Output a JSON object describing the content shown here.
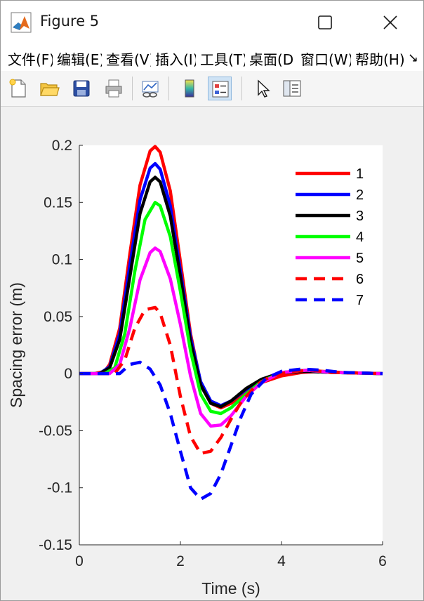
{
  "window": {
    "title": "Figure 5"
  },
  "menu": {
    "items": [
      "文件(F)",
      "编辑(E)",
      "查看(V)",
      "插入(I)",
      "工具(T)",
      "桌面(D)",
      "窗口(W)",
      "帮助(H)"
    ],
    "overflow_glyph": "↘"
  },
  "toolbar": {
    "buttons": [
      {
        "icon": "new-figure-icon"
      },
      {
        "icon": "open-file-icon"
      },
      {
        "icon": "save-icon"
      },
      {
        "icon": "print-icon"
      },
      {
        "icon": "link-plot-icon"
      },
      {
        "icon": "colorbar-icon"
      },
      {
        "icon": "legend-icon",
        "active": true
      },
      {
        "icon": "pointer-icon"
      },
      {
        "icon": "property-inspector-icon"
      }
    ]
  },
  "colors": {
    "accent_active": "#cfe3f5",
    "plot_background": "#ffffff",
    "figure_background": "#f0f0f0"
  },
  "chart_data": {
    "type": "line",
    "title": "",
    "xlabel": "Time (s)",
    "ylabel": "Spacing error (m)",
    "xlim": [
      0,
      6
    ],
    "ylim": [
      -0.15,
      0.2
    ],
    "xticks": [
      0,
      2,
      4,
      6
    ],
    "yticks": [
      -0.15,
      -0.1,
      -0.05,
      0,
      0.05,
      0.1,
      0.15,
      0.2
    ],
    "xtick_labels": [
      "0",
      "2",
      "4",
      "6"
    ],
    "ytick_labels": [
      "-0.15",
      "-0.1",
      "-0.05",
      "0",
      "0.05",
      "0.1",
      "0.15",
      "0.2"
    ],
    "grid": false,
    "legend_position": "top-right",
    "series": [
      {
        "name": "1",
        "color": "#ff0000",
        "dash": "solid",
        "x": [
          0,
          0.3,
          0.5,
          0.6,
          0.8,
          1.0,
          1.2,
          1.4,
          1.5,
          1.6,
          1.8,
          2.0,
          2.2,
          2.4,
          2.6,
          2.8,
          3.0,
          3.3,
          3.6,
          4.0,
          4.4,
          4.8,
          5.2,
          6.0
        ],
        "y": [
          0,
          0,
          0.002,
          0.008,
          0.04,
          0.105,
          0.165,
          0.195,
          0.199,
          0.194,
          0.16,
          0.098,
          0.035,
          -0.008,
          -0.026,
          -0.03,
          -0.026,
          -0.016,
          -0.008,
          -0.002,
          0.001,
          0.002,
          0.001,
          0
        ]
      },
      {
        "name": "2",
        "color": "#0000ff",
        "dash": "solid",
        "x": [
          0,
          0.4,
          0.6,
          0.8,
          1.0,
          1.2,
          1.4,
          1.5,
          1.6,
          1.8,
          2.0,
          2.2,
          2.4,
          2.6,
          2.8,
          3.0,
          3.3,
          3.6,
          4.0,
          4.5,
          5.0,
          6.0
        ],
        "y": [
          0,
          0,
          0.006,
          0.035,
          0.095,
          0.152,
          0.18,
          0.184,
          0.179,
          0.147,
          0.09,
          0.032,
          -0.007,
          -0.024,
          -0.028,
          -0.024,
          -0.014,
          -0.006,
          0.001,
          0.002,
          0.001,
          0
        ]
      },
      {
        "name": "3",
        "color": "#000000",
        "dash": "solid",
        "x": [
          0,
          0.4,
          0.6,
          0.8,
          1.0,
          1.2,
          1.4,
          1.5,
          1.6,
          1.8,
          2.0,
          2.2,
          2.4,
          2.6,
          2.8,
          3.0,
          3.3,
          3.6,
          4.0,
          4.5,
          5.0,
          6.0
        ],
        "y": [
          0,
          0,
          0.005,
          0.03,
          0.085,
          0.14,
          0.168,
          0.172,
          0.168,
          0.138,
          0.085,
          0.028,
          -0.01,
          -0.026,
          -0.029,
          -0.024,
          -0.013,
          -0.005,
          0.001,
          0.002,
          0.001,
          0
        ]
      },
      {
        "name": "4",
        "color": "#00ff00",
        "dash": "solid",
        "x": [
          0,
          0.5,
          0.7,
          0.9,
          1.1,
          1.3,
          1.5,
          1.6,
          1.8,
          2.0,
          2.2,
          2.4,
          2.6,
          2.8,
          3.0,
          3.3,
          3.6,
          4.0,
          4.5,
          5.0,
          6.0
        ],
        "y": [
          0,
          0,
          0.005,
          0.035,
          0.09,
          0.135,
          0.15,
          0.147,
          0.12,
          0.072,
          0.02,
          -0.018,
          -0.033,
          -0.035,
          -0.03,
          -0.018,
          -0.007,
          0.001,
          0.003,
          0.001,
          0
        ]
      },
      {
        "name": "5",
        "color": "#ff00ff",
        "dash": "solid",
        "x": [
          0,
          0.6,
          0.8,
          1.0,
          1.2,
          1.4,
          1.5,
          1.6,
          1.8,
          2.0,
          2.2,
          2.4,
          2.6,
          2.8,
          3.0,
          3.3,
          3.6,
          4.0,
          4.5,
          5.0,
          6.0
        ],
        "y": [
          0,
          0,
          0.008,
          0.04,
          0.082,
          0.106,
          0.11,
          0.107,
          0.083,
          0.043,
          -0.002,
          -0.035,
          -0.046,
          -0.045,
          -0.037,
          -0.02,
          -0.008,
          0.001,
          0.003,
          0.001,
          0
        ]
      },
      {
        "name": "6",
        "color": "#ff0000",
        "dash": "dash",
        "x": [
          0,
          0.7,
          0.9,
          1.1,
          1.3,
          1.5,
          1.6,
          1.8,
          2.0,
          2.2,
          2.4,
          2.6,
          2.8,
          3.0,
          3.2,
          3.5,
          3.8,
          4.2,
          4.6,
          5.0,
          6.0
        ],
        "y": [
          0,
          0,
          0.012,
          0.04,
          0.056,
          0.058,
          0.053,
          0.025,
          -0.02,
          -0.055,
          -0.07,
          -0.068,
          -0.056,
          -0.04,
          -0.025,
          -0.01,
          -0.002,
          0.002,
          0.003,
          0.001,
          0
        ]
      },
      {
        "name": "7",
        "color": "#0000ff",
        "dash": "dash",
        "x": [
          0,
          0.8,
          1.0,
          1.2,
          1.4,
          1.6,
          1.8,
          2.0,
          2.2,
          2.4,
          2.6,
          2.8,
          3.0,
          3.2,
          3.4,
          3.7,
          4.0,
          4.4,
          4.8,
          5.2,
          6.0
        ],
        "y": [
          0,
          0,
          0.008,
          0.01,
          0.004,
          -0.01,
          -0.035,
          -0.068,
          -0.1,
          -0.11,
          -0.105,
          -0.088,
          -0.063,
          -0.038,
          -0.018,
          -0.004,
          0.002,
          0.004,
          0.003,
          0.001,
          0
        ]
      }
    ]
  }
}
